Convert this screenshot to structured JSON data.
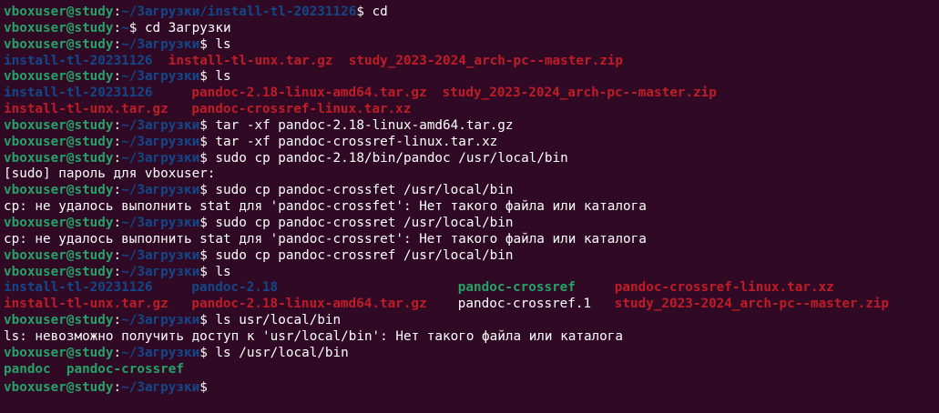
{
  "colors": {
    "background": "#300a24",
    "text": "#ffffff",
    "prompt_user": "#26a269",
    "prompt_path": "#12488b",
    "directory": "#12488b",
    "archive": "#c01c28",
    "executable": "#26a269"
  },
  "lines": [
    {
      "spans": [
        {
          "t": "vboxuser@study",
          "c": "user"
        },
        {
          "t": ":",
          "c": "plain"
        },
        {
          "t": "~/Загрузки/install-tl-20231126",
          "c": "path"
        },
        {
          "t": "$ cd",
          "c": "plain"
        }
      ]
    },
    {
      "spans": [
        {
          "t": "vboxuser@study",
          "c": "user"
        },
        {
          "t": ":",
          "c": "plain"
        },
        {
          "t": "~",
          "c": "path"
        },
        {
          "t": "$ cd Загрузки",
          "c": "plain"
        }
      ]
    },
    {
      "spans": [
        {
          "t": "vboxuser@study",
          "c": "user"
        },
        {
          "t": ":",
          "c": "plain"
        },
        {
          "t": "~/Загрузки",
          "c": "path"
        },
        {
          "t": "$ ls",
          "c": "plain"
        }
      ]
    },
    {
      "spans": [
        {
          "t": "install-tl-20231126",
          "c": "dir"
        },
        {
          "t": "  ",
          "c": "plain"
        },
        {
          "t": "install-tl-unx.tar.gz",
          "c": "arch"
        },
        {
          "t": "  ",
          "c": "plain"
        },
        {
          "t": "study_2023-2024_arch-pc--master.zip",
          "c": "arch"
        }
      ]
    },
    {
      "spans": [
        {
          "t": "vboxuser@study",
          "c": "user"
        },
        {
          "t": ":",
          "c": "plain"
        },
        {
          "t": "~/Загрузки",
          "c": "path"
        },
        {
          "t": "$ ls",
          "c": "plain"
        }
      ]
    },
    {
      "spans": [
        {
          "t": "install-tl-20231126",
          "c": "dir",
          "w": 24
        },
        {
          "t": "pandoc-2.18-linux-amd64.tar.gz",
          "c": "arch",
          "w": 32
        },
        {
          "t": "study_2023-2024_arch-pc--master.zip",
          "c": "arch"
        }
      ]
    },
    {
      "spans": [
        {
          "t": "install-tl-unx.tar.gz",
          "c": "arch",
          "w": 24
        },
        {
          "t": "pandoc-crossref-linux.tar.xz",
          "c": "arch"
        }
      ]
    },
    {
      "spans": [
        {
          "t": "vboxuser@study",
          "c": "user"
        },
        {
          "t": ":",
          "c": "plain"
        },
        {
          "t": "~/Загрузки",
          "c": "path"
        },
        {
          "t": "$ tar -xf pandoc-2.18-linux-amd64.tar.gz",
          "c": "plain"
        }
      ]
    },
    {
      "spans": [
        {
          "t": "vboxuser@study",
          "c": "user"
        },
        {
          "t": ":",
          "c": "plain"
        },
        {
          "t": "~/Загрузки",
          "c": "path"
        },
        {
          "t": "$ tar -xf pandoc-crossref-linux.tar.xz",
          "c": "plain"
        }
      ]
    },
    {
      "spans": [
        {
          "t": "vboxuser@study",
          "c": "user"
        },
        {
          "t": ":",
          "c": "plain"
        },
        {
          "t": "~/Загрузки",
          "c": "path"
        },
        {
          "t": "$ sudo cp pandoc-2.18/bin/pandoc /usr/local/bin",
          "c": "plain"
        }
      ]
    },
    {
      "spans": [
        {
          "t": "[sudo] пароль для vboxuser:",
          "c": "plain"
        }
      ]
    },
    {
      "spans": [
        {
          "t": "vboxuser@study",
          "c": "user"
        },
        {
          "t": ":",
          "c": "plain"
        },
        {
          "t": "~/Загрузки",
          "c": "path"
        },
        {
          "t": "$ sudo cp pandoc-crossfet /usr/local/bin",
          "c": "plain"
        }
      ]
    },
    {
      "spans": [
        {
          "t": "cp: не удалось выполнить stat для 'pandoc-crossfet': Нет такого файла или каталога",
          "c": "plain"
        }
      ]
    },
    {
      "spans": [
        {
          "t": "vboxuser@study",
          "c": "user"
        },
        {
          "t": ":",
          "c": "plain"
        },
        {
          "t": "~/Загрузки",
          "c": "path"
        },
        {
          "t": "$ sudo cp pandoc-crossret /usr/local/bin",
          "c": "plain"
        }
      ]
    },
    {
      "spans": [
        {
          "t": "cp: не удалось выполнить stat для 'pandoc-crossret': Нет такого файла или каталога",
          "c": "plain"
        }
      ]
    },
    {
      "spans": [
        {
          "t": "vboxuser@study",
          "c": "user"
        },
        {
          "t": ":",
          "c": "plain"
        },
        {
          "t": "~/Загрузки",
          "c": "path"
        },
        {
          "t": "$ sudo cp pandoc-crossref /usr/local/bin",
          "c": "plain"
        }
      ]
    },
    {
      "spans": [
        {
          "t": "vboxuser@study",
          "c": "user"
        },
        {
          "t": ":",
          "c": "plain"
        },
        {
          "t": "~/Загрузки",
          "c": "path"
        },
        {
          "t": "$ ls",
          "c": "plain"
        }
      ]
    },
    {
      "spans": [
        {
          "t": "install-tl-20231126",
          "c": "dir",
          "w": 24
        },
        {
          "t": "pandoc-2.18",
          "c": "dir",
          "w": 34
        },
        {
          "t": "pandoc-crossref",
          "c": "exec",
          "w": 20
        },
        {
          "t": "pandoc-crossref-linux.tar.xz",
          "c": "arch"
        }
      ]
    },
    {
      "spans": [
        {
          "t": "install-tl-unx.tar.gz",
          "c": "arch",
          "w": 24
        },
        {
          "t": "pandoc-2.18-linux-amd64.tar.gz",
          "c": "arch",
          "w": 34
        },
        {
          "t": "pandoc-crossref.1",
          "c": "plain",
          "w": 20
        },
        {
          "t": "study_2023-2024_arch-pc--master.zip",
          "c": "arch"
        }
      ]
    },
    {
      "spans": [
        {
          "t": "vboxuser@study",
          "c": "user"
        },
        {
          "t": ":",
          "c": "plain"
        },
        {
          "t": "~/Загрузки",
          "c": "path"
        },
        {
          "t": "$ ls usr/local/bin",
          "c": "plain"
        }
      ]
    },
    {
      "spans": [
        {
          "t": "ls: невозможно получить доступ к 'usr/local/bin': Нет такого файла или каталога",
          "c": "plain"
        }
      ]
    },
    {
      "spans": [
        {
          "t": "vboxuser@study",
          "c": "user"
        },
        {
          "t": ":",
          "c": "plain"
        },
        {
          "t": "~/Загрузки",
          "c": "path"
        },
        {
          "t": "$ ls /usr/local/bin",
          "c": "plain"
        }
      ]
    },
    {
      "spans": [
        {
          "t": "pandoc",
          "c": "exec"
        },
        {
          "t": "  ",
          "c": "plain"
        },
        {
          "t": "pandoc-crossref",
          "c": "exec"
        }
      ]
    },
    {
      "spans": [
        {
          "t": "vboxuser@study",
          "c": "user"
        },
        {
          "t": ":",
          "c": "plain"
        },
        {
          "t": "~/Загрузки",
          "c": "path"
        },
        {
          "t": "$ ",
          "c": "plain"
        }
      ]
    }
  ]
}
